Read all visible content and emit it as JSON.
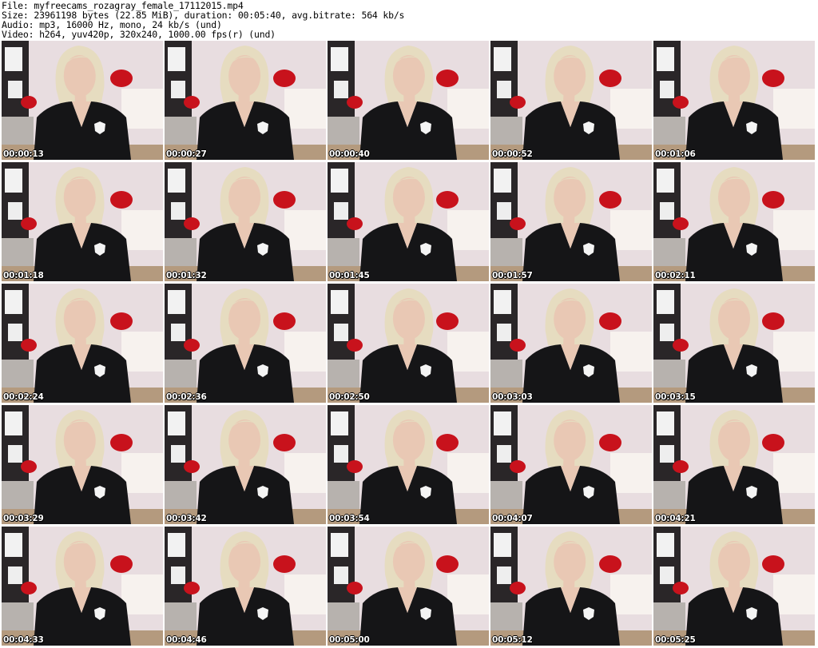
{
  "header": {
    "file": "File: myfreecams_rozagray_female_17112015.mp4",
    "size": "Size: 23961198 bytes (22.85 MiB), duration: 00:05:40, avg.bitrate: 564 kb/s",
    "audio": "Audio: mp3, 16000 Hz, mono, 24 kb/s (und)",
    "video": "Video: h264, yuv420p, 320x240, 1000.00 fps(r) (und)"
  },
  "thumbnails": [
    {
      "time": "00:00:13"
    },
    {
      "time": "00:00:27"
    },
    {
      "time": "00:00:40"
    },
    {
      "time": "00:00:52"
    },
    {
      "time": "00:01:06"
    },
    {
      "time": "00:01:18"
    },
    {
      "time": "00:01:32"
    },
    {
      "time": "00:01:45"
    },
    {
      "time": "00:01:57"
    },
    {
      "time": "00:02:11"
    },
    {
      "time": "00:02:24"
    },
    {
      "time": "00:02:36"
    },
    {
      "time": "00:02:50"
    },
    {
      "time": "00:03:03"
    },
    {
      "time": "00:03:15"
    },
    {
      "time": "00:03:29"
    },
    {
      "time": "00:03:42"
    },
    {
      "time": "00:03:54"
    },
    {
      "time": "00:04:07"
    },
    {
      "time": "00:04:21"
    },
    {
      "time": "00:04:33"
    },
    {
      "time": "00:04:46"
    },
    {
      "time": "00:05:00"
    },
    {
      "time": "00:05:12"
    },
    {
      "time": "00:05:25"
    }
  ],
  "colors": {
    "wall": "#e8dde0",
    "hair": "#e6dcc0",
    "skin": "#e9c8b4",
    "uniform": "#151517",
    "pillow": "#c8121c",
    "badge": "#f4f4f4"
  }
}
